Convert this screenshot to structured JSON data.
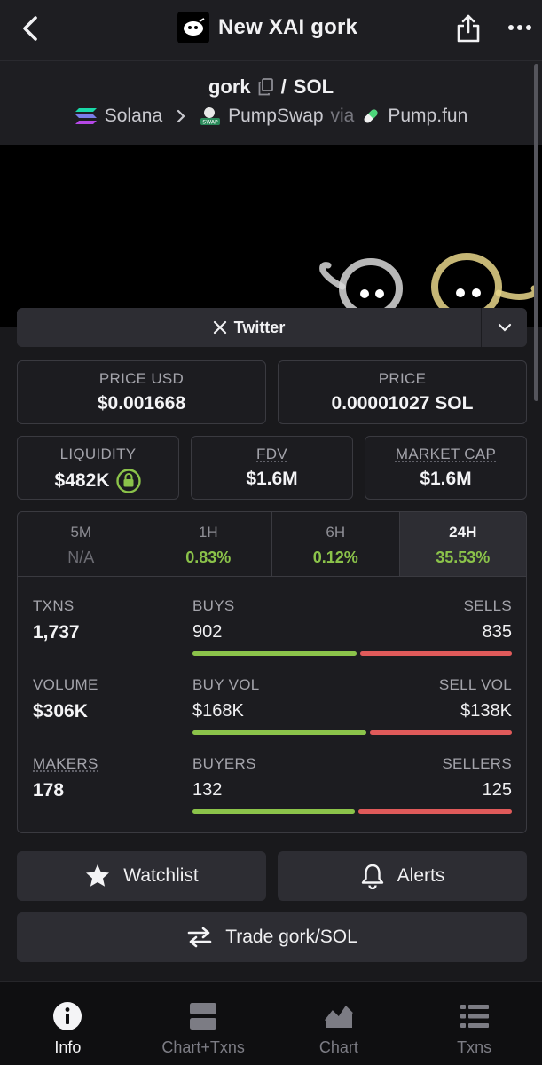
{
  "header": {
    "title": "New XAI gork",
    "back_icon": "chevron-left-icon",
    "share_icon": "share-icon",
    "more_icon": "more-dots-icon"
  },
  "pair": {
    "base": "gork",
    "separator": "/",
    "quote": "SOL",
    "chain": "Solana",
    "dex": "PumpSwap",
    "via": "via",
    "launchpad": "Pump.fun"
  },
  "socials": {
    "twitter_label": "Twitter"
  },
  "prices": {
    "price_usd_label": "PRICE USD",
    "price_usd": "$0.001668",
    "price_label": "PRICE",
    "price": "0.00001027 SOL"
  },
  "metrics": {
    "liquidity_label": "LIQUIDITY",
    "liquidity": "$482K",
    "fdv_label": "FDV",
    "fdv": "$1.6M",
    "mcap_label": "MARKET CAP",
    "mcap": "$1.6M"
  },
  "timeframes": [
    {
      "label": "5M",
      "value": "N/A",
      "active": false
    },
    {
      "label": "1H",
      "value": "0.83%",
      "active": false
    },
    {
      "label": "6H",
      "value": "0.12%",
      "active": false
    },
    {
      "label": "24H",
      "value": "35.53%",
      "active": true
    }
  ],
  "activity": {
    "txns_label": "TXNS",
    "txns": "1,737",
    "volume_label": "VOLUME",
    "volume": "$306K",
    "makers_label": "MAKERS",
    "makers": "178",
    "buys_label": "BUYS",
    "buys": "902",
    "sells_label": "SELLS",
    "sells": "835",
    "buy_vol_label": "BUY VOL",
    "buy_vol": "$168K",
    "sell_vol_label": "SELL VOL",
    "sell_vol": "$138K",
    "buyers_label": "BUYERS",
    "buyers": "132",
    "sellers_label": "SELLERS",
    "sellers": "125",
    "buy_share": 0.519,
    "buy_vol_share": 0.549,
    "buyer_share": 0.514,
    "buy_color": "#8bc34a",
    "sell_color": "#e05a5a"
  },
  "actions": {
    "watchlist": "Watchlist",
    "alerts": "Alerts",
    "trade": "Trade gork/SOL"
  },
  "bottom_nav": [
    {
      "label": "Info",
      "icon": "info-icon",
      "active": true
    },
    {
      "label": "Chart+Txns",
      "icon": "split-view-icon",
      "active": false
    },
    {
      "label": "Chart",
      "icon": "area-chart-icon",
      "active": false
    },
    {
      "label": "Txns",
      "icon": "list-icon",
      "active": false
    }
  ]
}
